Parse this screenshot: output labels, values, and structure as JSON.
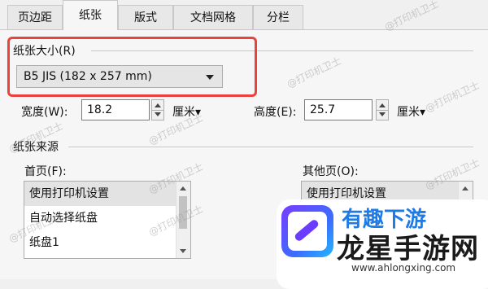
{
  "tabs": [
    "页边距",
    "纸张",
    "版式",
    "文档网格",
    "分栏"
  ],
  "active_tab": "纸张",
  "paper_size": {
    "label": "纸张大小(R)",
    "selected": "B5 JIS (182 x 257 mm)"
  },
  "width": {
    "label": "宽度(W):",
    "value": "18.2",
    "unit": "厘米▾"
  },
  "height": {
    "label": "高度(E):",
    "value": "25.7",
    "unit": "厘米▾"
  },
  "paper_source": {
    "label": "纸张来源",
    "first_page": {
      "label": "首页(F):",
      "items": [
        "使用打印机设置",
        "自动选择纸盘",
        "纸盘1"
      ]
    },
    "other_pages": {
      "label": "其他页(O):",
      "items": [
        "使用打印机设置"
      ]
    }
  },
  "watermark": "@打印机卫士",
  "overlay_logo": {
    "top_text": "有趣下游",
    "title": "龙星手游网",
    "url": "www.ahlongxing.com",
    "colors": {
      "purple": "#7a3cff",
      "blue": "#1e7be6"
    }
  },
  "colors": {
    "highlight_border": "#e8433d"
  }
}
